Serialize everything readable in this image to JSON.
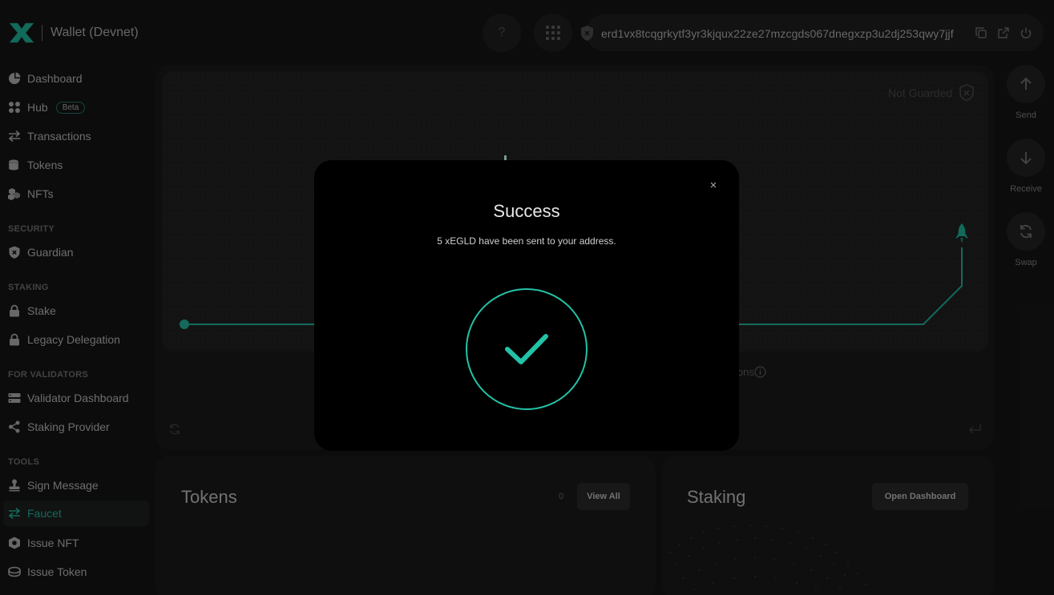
{
  "header": {
    "app_title": "Wallet (Devnet)",
    "help_label": "?",
    "address": "erd1vx8tcqgrkytf3yr3kjqux22ze27mzcgds067dnegxzp3u2dj253qwy7jjf"
  },
  "sidebar": {
    "items": [
      {
        "label": "Dashboard",
        "icon": "pie-chart-icon"
      },
      {
        "label": "Hub",
        "icon": "grid-dots-icon",
        "badge": "Beta"
      },
      {
        "label": "Transactions",
        "icon": "arrows-exchange-icon"
      },
      {
        "label": "Tokens",
        "icon": "coins-icon"
      },
      {
        "label": "NFTs",
        "icon": "cubes-icon"
      }
    ],
    "sections": [
      {
        "label": "SECURITY",
        "items": [
          {
            "label": "Guardian",
            "icon": "shield-x-icon"
          }
        ]
      },
      {
        "label": "STAKING",
        "items": [
          {
            "label": "Stake",
            "icon": "lock-icon"
          },
          {
            "label": "Legacy Delegation",
            "icon": "lock-icon"
          }
        ]
      },
      {
        "label": "FOR VALIDATORS",
        "items": [
          {
            "label": "Validator Dashboard",
            "icon": "server-icon"
          },
          {
            "label": "Staking Provider",
            "icon": "share-icon"
          }
        ]
      },
      {
        "label": "TOOLS",
        "items": [
          {
            "label": "Sign Message",
            "icon": "stamp-icon"
          },
          {
            "label": "Faucet",
            "icon": "arrows-exchange-icon",
            "active": true
          },
          {
            "label": "Issue NFT",
            "icon": "nft-icon"
          },
          {
            "label": "Issue Token",
            "icon": "coin-stack-icon"
          }
        ]
      }
    ]
  },
  "main": {
    "guard_status": "Not Guarded",
    "hidden_label_fragment": "ons",
    "actions": [
      {
        "label": "Send",
        "icon": "arrow-up-icon"
      },
      {
        "label": "Receive",
        "icon": "arrow-down-icon"
      },
      {
        "label": "Swap",
        "icon": "refresh-icon"
      }
    ]
  },
  "tokens_card": {
    "title": "Tokens",
    "count": "0",
    "button": "View All"
  },
  "staking_card": {
    "title": "Staking",
    "button": "Open Dashboard"
  },
  "modal": {
    "title": "Success",
    "message": "5 xEGLD have been sent to your address.",
    "close_label": "×"
  },
  "colors": {
    "accent": "#23c2a6",
    "background": "#171717",
    "modal": "#000000"
  }
}
